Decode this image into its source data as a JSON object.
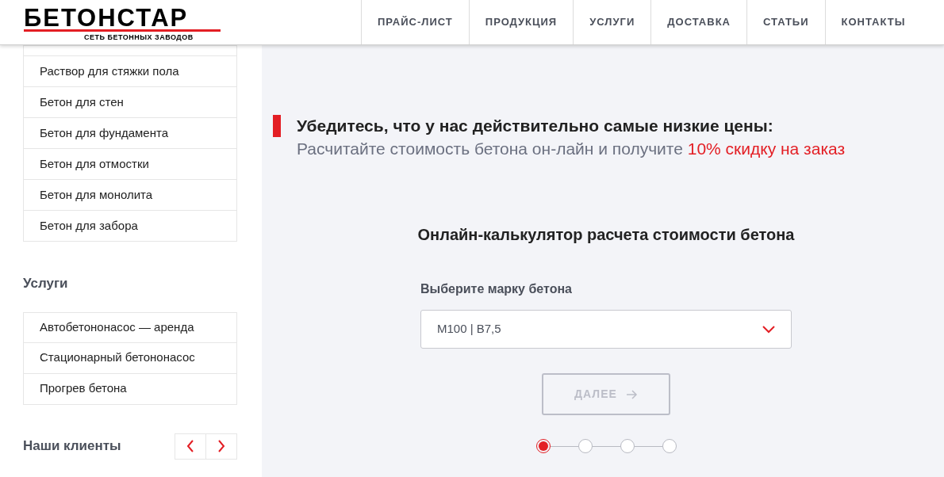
{
  "header": {
    "logo": {
      "name": "БЕТОНСТАР",
      "tagline": "СЕТЬ БЕТОННЫХ ЗАВОДОВ"
    },
    "nav": [
      {
        "label": "ПРАЙС-ЛИСТ",
        "selected": false
      },
      {
        "label": "ПРОДУКЦИЯ",
        "selected": false
      },
      {
        "label": "УСЛУГИ",
        "selected": false
      },
      {
        "label": "ДОСТАВКА",
        "selected": false
      },
      {
        "label": "СТАТЬИ",
        "selected": false
      },
      {
        "label": "КОНТАКТЫ",
        "selected": false
      }
    ]
  },
  "sidebar": {
    "products": [
      "Раствор для стяжки пола",
      "Бетон для стен",
      "Бетон для фундамента",
      "Бетон для отмостки",
      "Бетон для монолита",
      "Бетон для забора"
    ],
    "services_title": "Услуги",
    "services": [
      "Автобетононасос — аренда",
      "Стационарный бетононасос",
      "Прогрев бетона"
    ],
    "clients_title": "Наши клиенты"
  },
  "promo": {
    "title": "Убедитесь, что у нас действительно самые низкие цены:",
    "text": "Расчитайте стоимость бетона он-лайн и получите ",
    "highlight": "10% скидку на заказ"
  },
  "calculator": {
    "title": "Онлайн-калькулятор расчета стоимости бетона",
    "label": "Выберите марку бетона",
    "value": "М100 | В7,5",
    "button": {
      "label": "ДАЛЕЕ",
      "disabled": true
    },
    "steps": [
      {
        "selected": true
      },
      {
        "selected": false
      },
      {
        "selected": false
      },
      {
        "selected": false
      }
    ]
  }
}
